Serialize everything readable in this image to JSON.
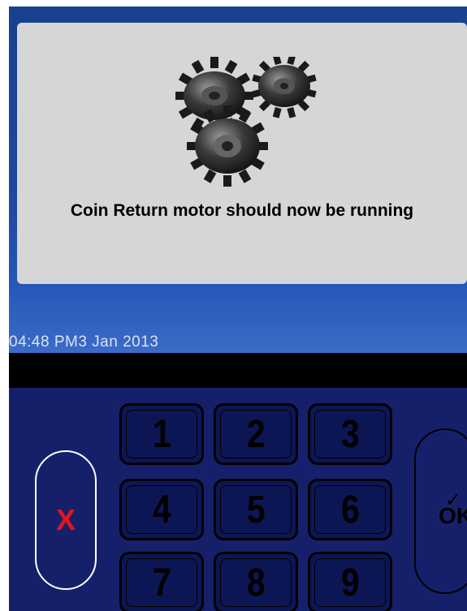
{
  "message": {
    "text": "Coin Return motor should now be running"
  },
  "status": {
    "clock": "04:48 PM3 Jan 2013"
  },
  "keypad": {
    "keys": [
      "1",
      "2",
      "3",
      "4",
      "5",
      "6",
      "7",
      "8",
      "9"
    ],
    "cancel_label": "X",
    "ok_label": "OK",
    "ok_check": "✓"
  },
  "colors": {
    "panel_blue": "#1f4aa3",
    "keypad_navy": "#16206a",
    "cancel_red": "#e8141b",
    "card_gray": "#d6d6d6"
  },
  "icons": {
    "animation": "gears-icon"
  }
}
